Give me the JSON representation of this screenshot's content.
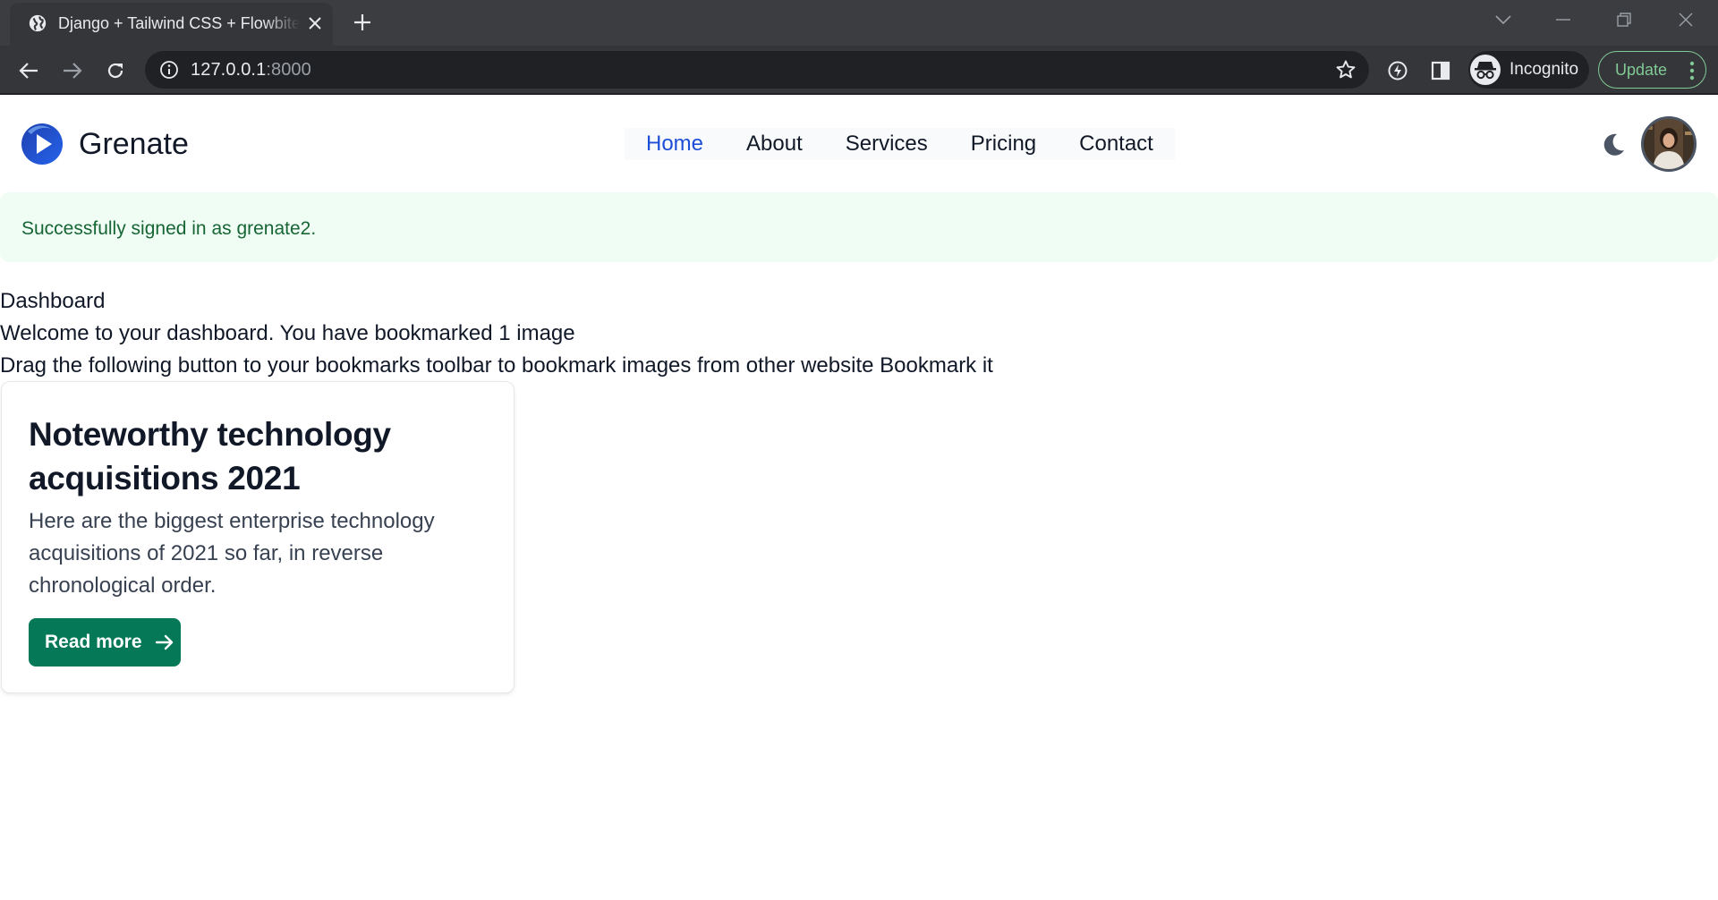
{
  "browser": {
    "tab_title": "Django + Tailwind CSS + Flowbite",
    "url_host": "127.0.0.1",
    "url_port": ":8000",
    "profile_label": "Incognito",
    "update_label": "Update"
  },
  "site": {
    "brand": "Grenate",
    "nav": [
      {
        "label": "Home",
        "active": true
      },
      {
        "label": "About"
      },
      {
        "label": "Services"
      },
      {
        "label": "Pricing"
      },
      {
        "label": "Contact"
      }
    ]
  },
  "alert": {
    "message": "Successfully signed in as grenate2."
  },
  "dashboard": {
    "heading": "Dashboard",
    "welcome": "Welcome to your dashboard. You have bookmarked 1 image",
    "instruction": "Drag the following button to your bookmarks toolbar to bookmark images from other website Bookmark it"
  },
  "card": {
    "title": "Noteworthy technology acquisitions 2021",
    "description": "Here are the biggest enterprise technology acquisitions of 2021 so far, in reverse chronological order.",
    "button_label": "Read more"
  },
  "colors": {
    "nav_active": "#1d4ed8",
    "alert_bg": "#f0fdf4",
    "alert_text": "#166534",
    "button_bg": "#047857"
  }
}
